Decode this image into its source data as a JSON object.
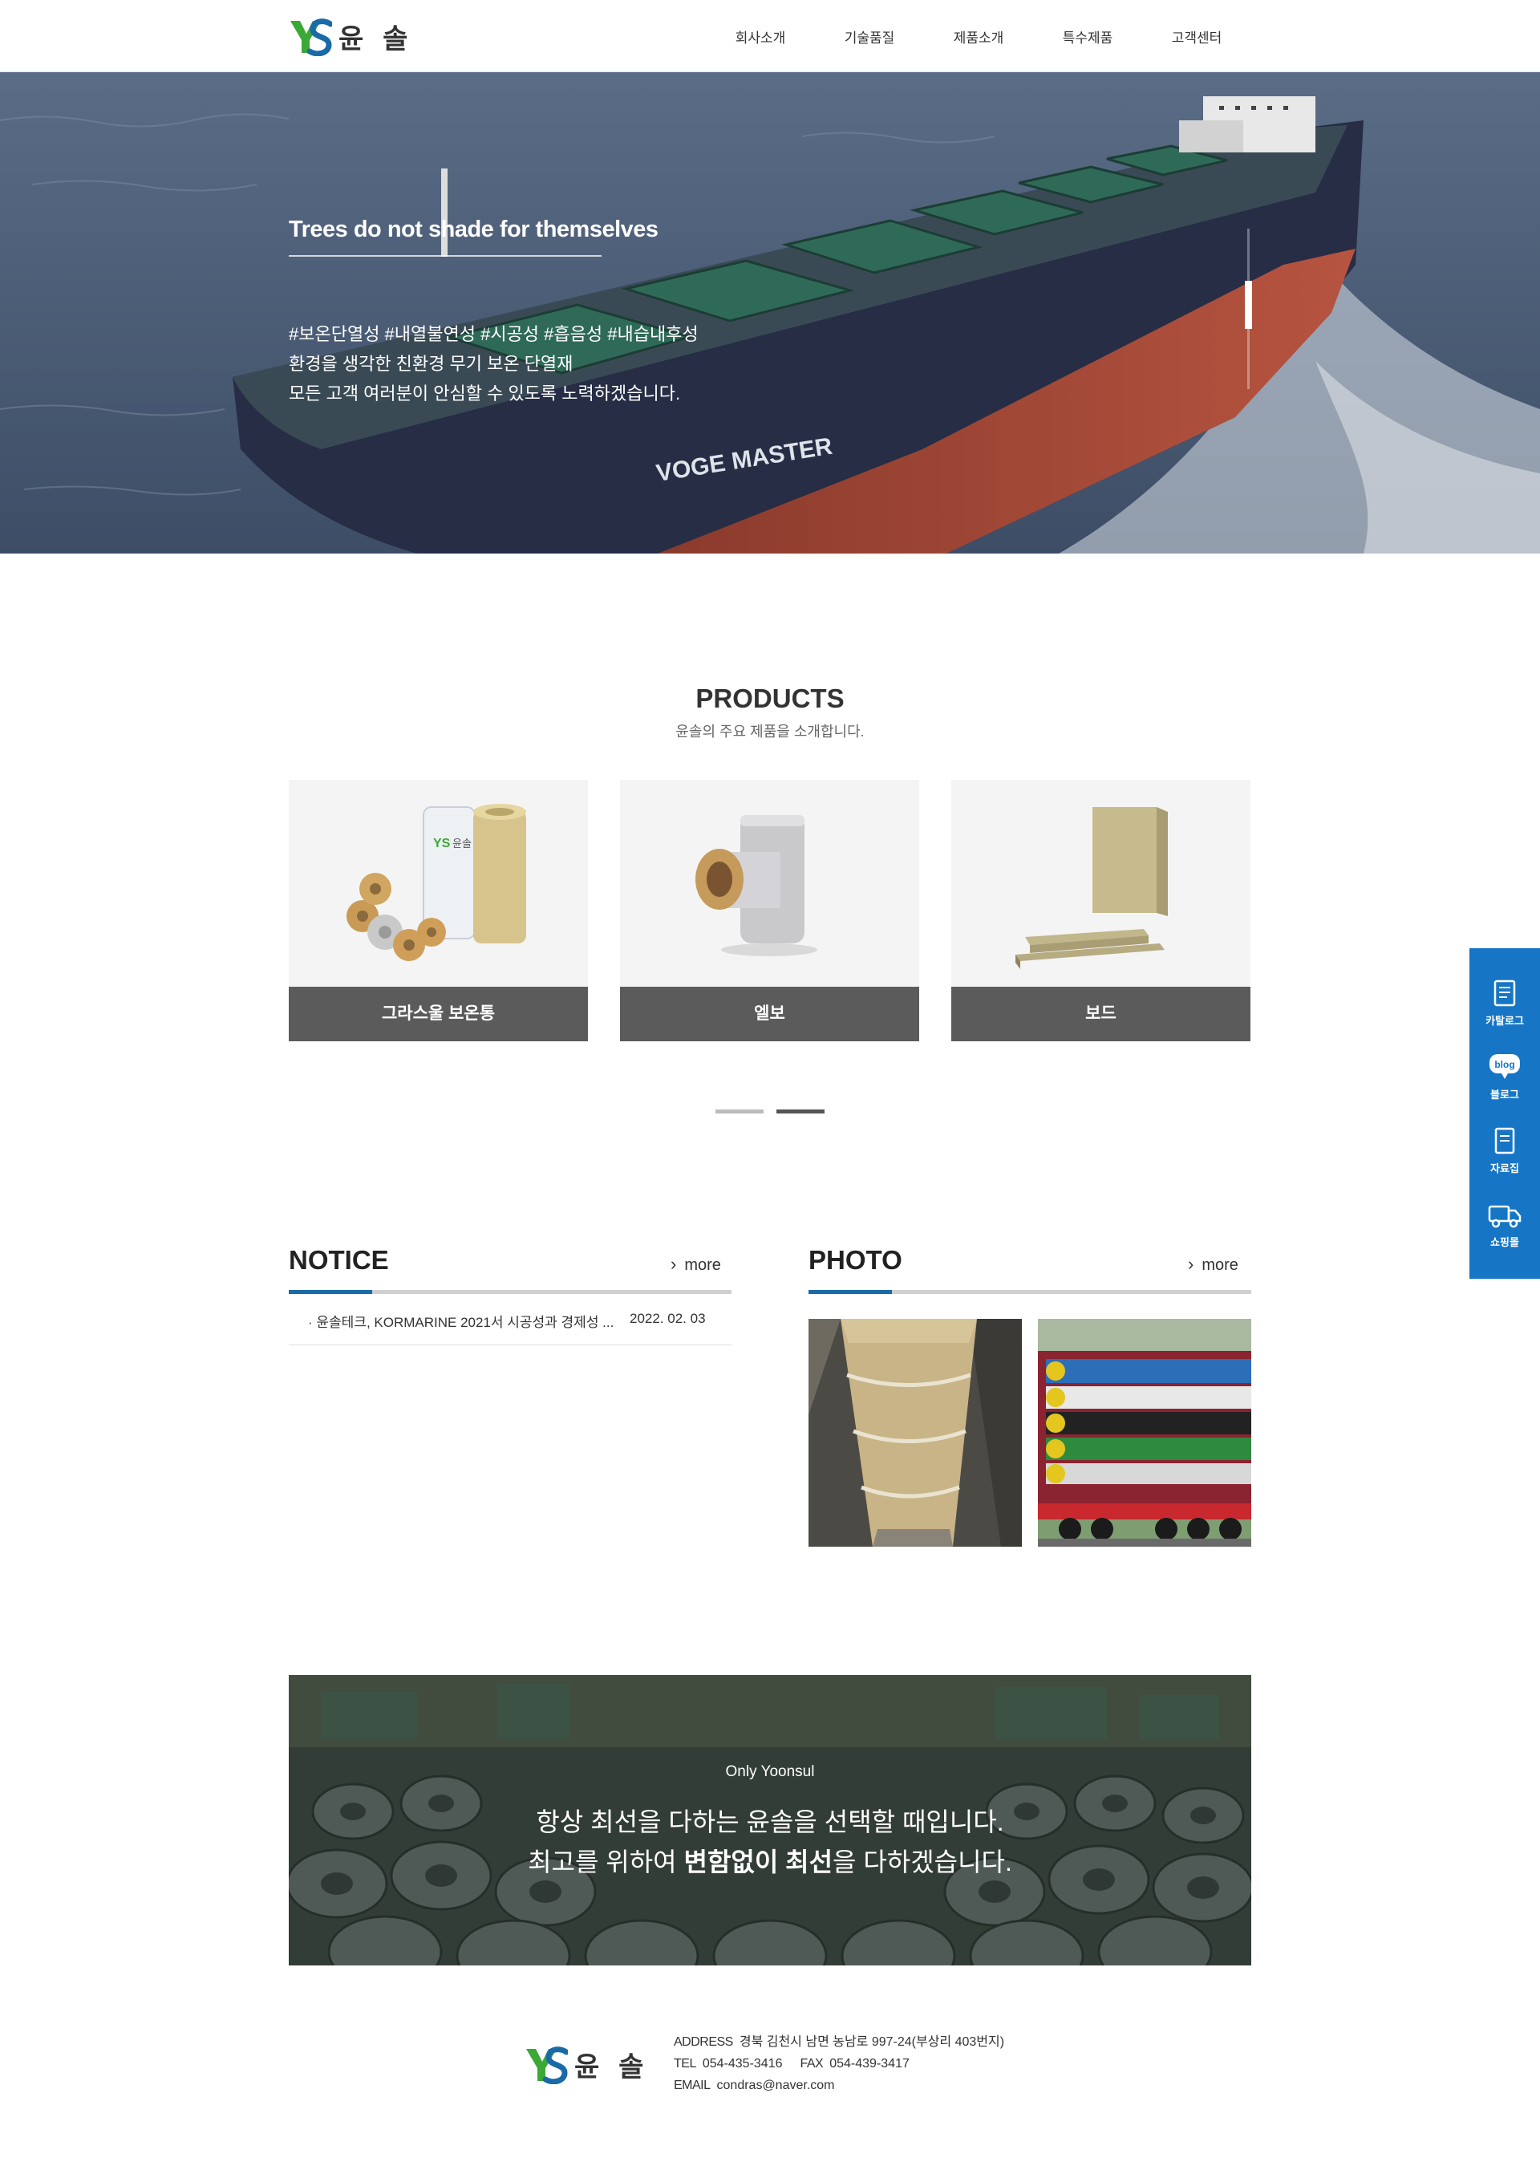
{
  "brand": {
    "name": "윤 솔",
    "mark_letters": "YS",
    "colors": {
      "primary": "#1676c5",
      "accent_green": "#3aa935",
      "accent_blue": "#1a6aa8",
      "caption_gray": "#5b5b5b"
    }
  },
  "nav": {
    "items": [
      {
        "label": "회사소개"
      },
      {
        "label": "기술품질"
      },
      {
        "label": "제품소개"
      },
      {
        "label": "특수제품"
      },
      {
        "label": "고객센터"
      }
    ]
  },
  "hero": {
    "title": "Trees do not shade for themselves",
    "lines": [
      "#보온단열성 #내열불연성 #시공성 #흡음성 #내습내후성",
      "환경을 생각한 친환경 무기 보온 단열재",
      "모든 고객 여러분이 안심할 수 있도록 노력하겠습니다."
    ],
    "ship_name": "VOGE MASTER",
    "slide_count": 3,
    "active_slide": 2
  },
  "products": {
    "title": "PRODUCTS",
    "subtitle": "윤솔의 주요 제품을 소개합니다.",
    "items": [
      {
        "label": "그라스울 보온통",
        "icon": "pipe-insulation-image"
      },
      {
        "label": "엘보",
        "icon": "elbow-fitting-image"
      },
      {
        "label": "보드",
        "icon": "board-panel-image"
      }
    ],
    "pager_count": 2,
    "pager_active": 2
  },
  "notice": {
    "title": "NOTICE",
    "more_label": "more",
    "rows": [
      {
        "title": "· 윤솔테크, KORMARINE 2021서 시공성과 경제성 ...",
        "date": "2022. 02. 03"
      }
    ]
  },
  "photo": {
    "title": "PHOTO",
    "more_label": "more",
    "items": [
      {
        "icon": "insulated-pipe-photo"
      },
      {
        "icon": "pipe-shipment-truck-photo"
      }
    ]
  },
  "banner": {
    "small": "Only Yoonsul",
    "line1": "항상 최선을 다하는 윤솔을 선택할 때입니다.",
    "line2_pre": "최고를 위하여 ",
    "line2_bold": "변함없이 최선",
    "line2_post": "을 다하겠습니다."
  },
  "footer": {
    "address_label": "ADDRESS",
    "address": "경북 김천시 남면 농남로 997-24(부상리 403번지)",
    "tel_label": "TEL",
    "tel": "054-435-3416",
    "fax_label": "FAX",
    "fax": "054-439-3417",
    "email_label": "EMAIL",
    "email": "condras@naver.com"
  },
  "quick_menu": {
    "items": [
      {
        "label": "카탈로그",
        "icon": "catalog-icon"
      },
      {
        "label": "블로그",
        "icon": "blog-icon",
        "badge": "blog"
      },
      {
        "label": "자료집",
        "icon": "document-icon"
      },
      {
        "label": "쇼핑몰",
        "icon": "truck-icon"
      }
    ]
  }
}
